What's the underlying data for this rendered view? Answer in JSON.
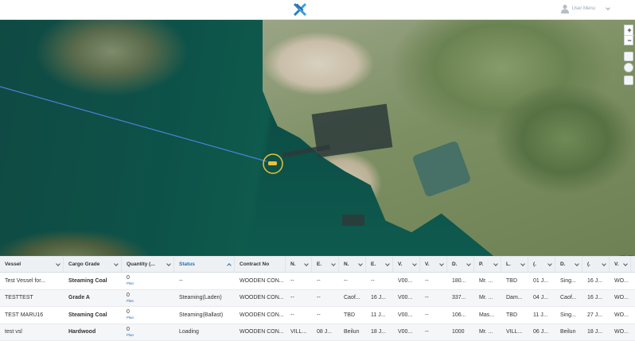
{
  "header": {
    "user_menu_label": "User Menu",
    "logo_icon": "company-logo-x"
  },
  "map": {
    "zoom_in": "+",
    "zoom_out": "−",
    "route_color": "#4f7fd8",
    "vessel_marker_color": "#e8c33a"
  },
  "grid": {
    "columns": [
      {
        "label": "Vessel"
      },
      {
        "label": "Cargo Grade"
      },
      {
        "label": "Quantity (..."
      },
      {
        "label": "Status",
        "sorted": true
      },
      {
        "label": "Contract No"
      },
      {
        "label": "N."
      },
      {
        "label": "E."
      },
      {
        "label": "N."
      },
      {
        "label": "E."
      },
      {
        "label": "V."
      },
      {
        "label": "V."
      },
      {
        "label": "D."
      },
      {
        "label": "P."
      },
      {
        "label": "L."
      },
      {
        "label": "(."
      },
      {
        "label": "D."
      },
      {
        "label": "(."
      },
      {
        "label": "V."
      }
    ],
    "rows": [
      {
        "vessel": "Test Vessel for...",
        "cargo": "Steaming Coal",
        "qty": "0",
        "plan": "Plan",
        "status": "--",
        "contract": "WOODEN CON...",
        "c6": "--",
        "c7": "--",
        "c8": "--",
        "c9": "--",
        "c10": "V00...",
        "c11": "--",
        "c12": "180...",
        "c13": "Mr. ...",
        "c14": "TBD",
        "c15": "01 J...",
        "c16": "Sing...",
        "c17": "16 J...",
        "c18": "WO..."
      },
      {
        "vessel": "TESTTEST",
        "cargo": "Grade A",
        "qty": "0",
        "plan": "Plan",
        "status": "Steaming(Laden)",
        "contract": "WOODEN CON...",
        "c6": "--",
        "c7": "--",
        "c8": "Caof...",
        "c9": "16 J...",
        "c10": "V00...",
        "c11": "--",
        "c12": "337...",
        "c13": "Mr. ...",
        "c14": "Dam...",
        "c15": "04 J...",
        "c16": "Caof...",
        "c17": "16 J...",
        "c18": "WO..."
      },
      {
        "vessel": "TEST MARU16",
        "cargo": "Steaming Coal",
        "qty": "0",
        "plan": "Plan",
        "status": "Steaming(Ballast)",
        "contract": "WOODEN CON...",
        "c6": "--",
        "c7": "--",
        "c8": "TBD",
        "c9": "11 J...",
        "c10": "V00...",
        "c11": "--",
        "c12": "106...",
        "c13": "Mas...",
        "c14": "TBD",
        "c15": "11 J...",
        "c16": "Sing...",
        "c17": "27 J...",
        "c18": "WO..."
      },
      {
        "vessel": "test vsl",
        "cargo": "Hardwood",
        "qty": "0",
        "plan": "Plan",
        "status": "Loading",
        "contract": "WOODEN CON...",
        "c6": "VILL...",
        "c7": "08 J...",
        "c8": "Beilun",
        "c9": "18 J...",
        "c10": "V00...",
        "c11": "--",
        "c12": "1000",
        "c13": "Mr. ...",
        "c14": "VILL...",
        "c15": "06 J...",
        "c16": "Beilun",
        "c17": "18 J...",
        "c18": "WO..."
      }
    ]
  }
}
